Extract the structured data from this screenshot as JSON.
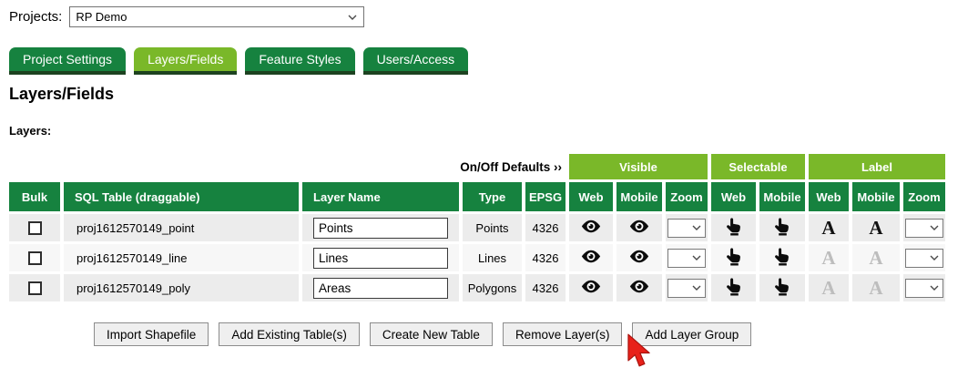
{
  "colors": {
    "dark_green": "#16823f",
    "light_green": "#7ab829",
    "tab_underline": "#1d4220",
    "row_gray": "#ececec",
    "row_light": "#f7f7f7",
    "disabled_gray": "#bdbdbd",
    "cursor_red": "#e8211a"
  },
  "projects": {
    "label": "Projects:",
    "selected": "RP Demo"
  },
  "tabs": [
    {
      "label": "Project Settings",
      "active": false
    },
    {
      "label": "Layers/Fields",
      "active": true
    },
    {
      "label": "Feature Styles",
      "active": false
    },
    {
      "label": "Users/Access",
      "active": false
    }
  ],
  "page_title": "Layers/Fields",
  "section_label": "Layers:",
  "table": {
    "on_off_defaults": "On/Off Defaults ››",
    "groups": [
      {
        "label": "Visible",
        "span": 3
      },
      {
        "label": "Selectable",
        "span": 2
      },
      {
        "label": "Label",
        "span": 3
      }
    ],
    "columns": [
      "Bulk",
      "SQL Table (draggable)",
      "Layer Name",
      "Type",
      "EPSG",
      "Web",
      "Mobile",
      "Zoom",
      "Web",
      "Mobile",
      "Web",
      "Mobile",
      "Zoom"
    ],
    "rows": [
      {
        "sql_table": "proj1612570149_point",
        "layer_name_value": "Points",
        "type": "Points",
        "epsg": "4326",
        "visible_web": "on",
        "visible_mobile": "on",
        "visible_zoom": "",
        "selectable_web": "on",
        "selectable_mobile": "on",
        "label_web": "on",
        "label_mobile": "on",
        "label_zoom": ""
      },
      {
        "sql_table": "proj1612570149_line",
        "layer_name_value": "Lines",
        "type": "Lines",
        "epsg": "4326",
        "visible_web": "on",
        "visible_mobile": "on",
        "visible_zoom": "",
        "selectable_web": "on",
        "selectable_mobile": "on",
        "label_web": "off",
        "label_mobile": "off",
        "label_zoom": ""
      },
      {
        "sql_table": "proj1612570149_poly",
        "layer_name_value": "Areas",
        "type": "Polygons",
        "epsg": "4326",
        "visible_web": "on",
        "visible_mobile": "on",
        "visible_zoom": "",
        "selectable_web": "on",
        "selectable_mobile": "on",
        "label_web": "off",
        "label_mobile": "off",
        "label_zoom": ""
      }
    ]
  },
  "buttons": [
    "Import Shapefile",
    "Add Existing Table(s)",
    "Create New Table",
    "Remove Layer(s)",
    "Add Layer Group"
  ],
  "icons": {
    "visible": "eye-icon",
    "selectable": "hand-pointer-icon",
    "label": "letter-a-icon",
    "pointer": "red-arrow-cursor"
  }
}
